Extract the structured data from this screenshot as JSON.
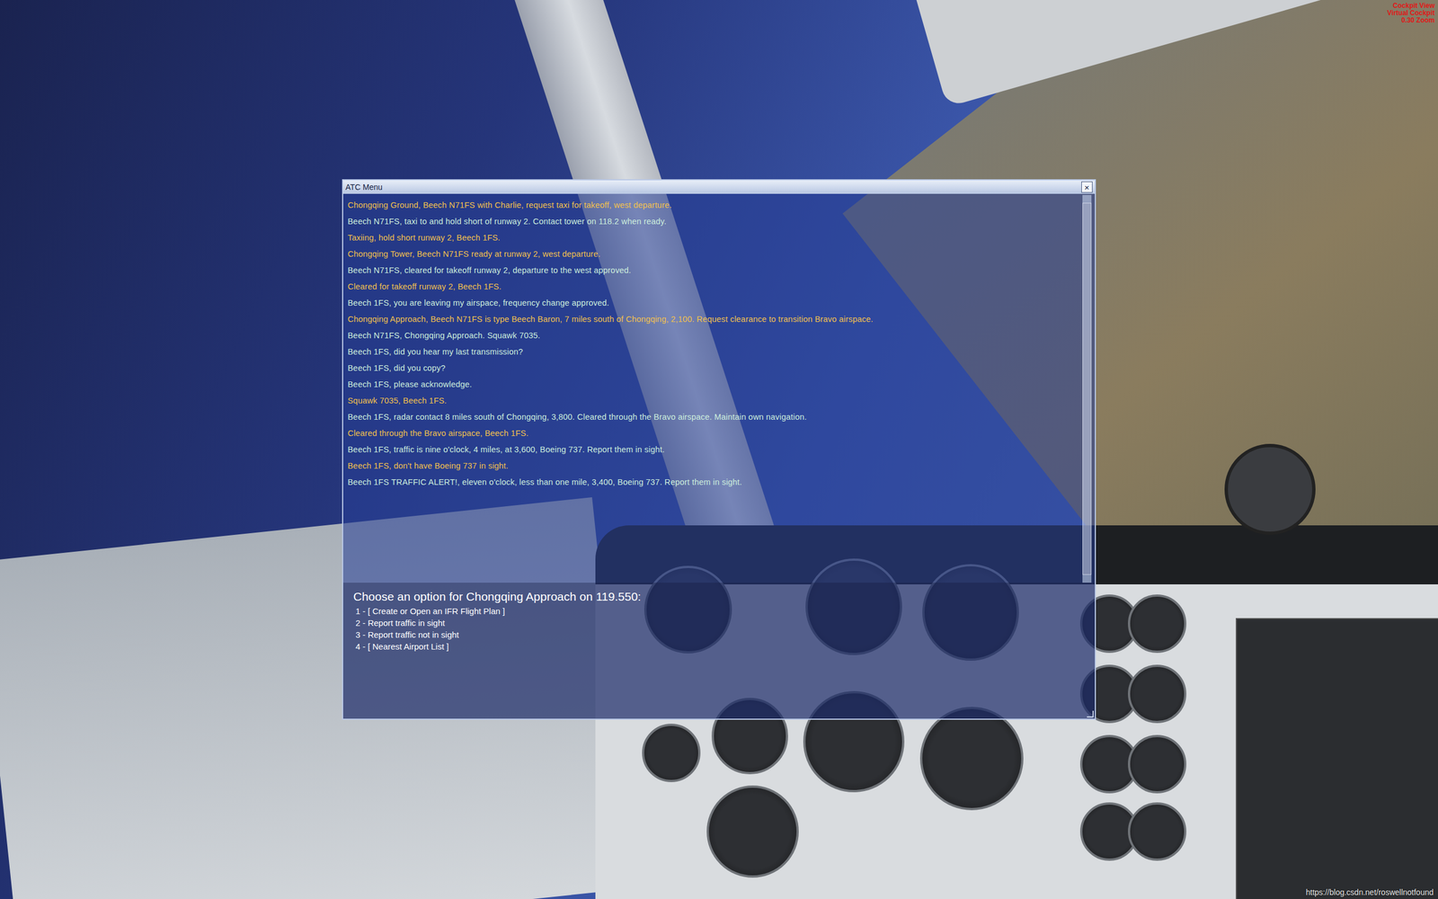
{
  "overlay": {
    "lines": [
      "Cockpit View",
      "Virtual Cockpit",
      "0.30 Zoom"
    ]
  },
  "window": {
    "title": "ATC Menu",
    "close": "×"
  },
  "messages": [
    {
      "text": "Chongqing Ground, Beech N71FS with Charlie, request taxi for takeoff, west departure.",
      "speaker": "pilot",
      "color": "#f2c14e"
    },
    {
      "text": "Beech N71FS, taxi to and hold short of runway 2. Contact tower on 118.2 when ready.",
      "speaker": "atc",
      "color": "#cdeedd"
    },
    {
      "text": "Taxiing, hold short runway 2, Beech 1FS.",
      "speaker": "pilot",
      "color": "#f2c14e"
    },
    {
      "text": "Chongqing Tower, Beech N71FS ready at runway 2, west departure.",
      "speaker": "pilot",
      "color": "#f2c14e"
    },
    {
      "text": "Beech N71FS, cleared for takeoff runway 2, departure to the west approved.",
      "speaker": "atc",
      "color": "#cdeedd"
    },
    {
      "text": "Cleared for takeoff runway 2, Beech 1FS.",
      "speaker": "pilot",
      "color": "#f2c14e"
    },
    {
      "text": "Beech 1FS, you are leaving my airspace, frequency change approved.",
      "speaker": "atc",
      "color": "#cdeedd"
    },
    {
      "text": "Chongqing Approach, Beech N71FS is type Beech Baron, 7 miles south of Chongqing, 2,100. Request clearance to transition Bravo airspace.",
      "speaker": "pilot",
      "color": "#f2c14e"
    },
    {
      "text": "Beech N71FS, Chongqing Approach. Squawk 7035.",
      "speaker": "atc",
      "color": "#cdeedd"
    },
    {
      "text": "Beech 1FS, did you hear my last transmission?",
      "speaker": "atc",
      "color": "#cdeedd"
    },
    {
      "text": "Beech 1FS, did you copy?",
      "speaker": "atc",
      "color": "#cdeedd"
    },
    {
      "text": "Beech 1FS, please acknowledge.",
      "speaker": "atc",
      "color": "#cdeedd"
    },
    {
      "text": "Squawk 7035, Beech 1FS.",
      "speaker": "pilot",
      "color": "#f2c14e"
    },
    {
      "text": "Beech 1FS, radar contact 8 miles south of Chongqing, 3,800. Cleared through the Bravo airspace. Maintain own navigation.",
      "speaker": "atc",
      "color": "#cdeedd"
    },
    {
      "text": "Cleared through the Bravo airspace, Beech 1FS.",
      "speaker": "pilot",
      "color": "#f2c14e"
    },
    {
      "text": "Beech 1FS, traffic is nine o'clock, 4 miles, at 3,600, Boeing 737. Report them in sight.",
      "speaker": "atc",
      "color": "#cdeedd"
    },
    {
      "text": "Beech 1FS, don't have Boeing 737 in sight.",
      "speaker": "pilot",
      "color": "#f2c14e"
    },
    {
      "text": "Beech 1FS TRAFFIC ALERT!, eleven o'clock, less than one mile, 3,400, Boeing 737. Report them in sight.",
      "speaker": "atc",
      "color": "#cdeedd"
    }
  ],
  "scrollbar": {
    "level": 1
  },
  "prompt": "Choose an option for Chongqing Approach on 119.550:",
  "options": [
    "1 - [ Create or Open an IFR Flight Plan ]",
    "2 - Report traffic in sight",
    "3 - Report traffic not in sight",
    "4 - [ Nearest Airport List ]"
  ],
  "watermark": "https://blog.csdn.net/roswellnotfound"
}
